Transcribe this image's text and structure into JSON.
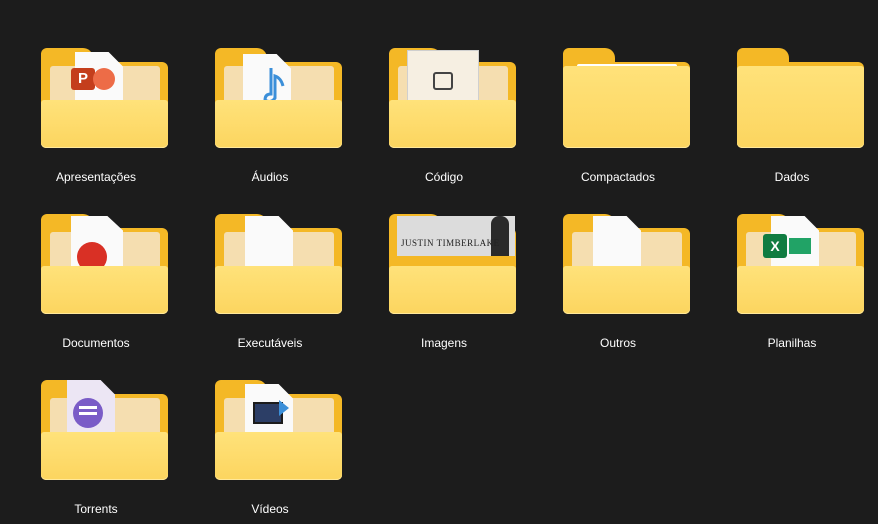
{
  "folders": [
    {
      "name": "Apresentações",
      "preview": "powerpoint-icon"
    },
    {
      "name": "Áudios",
      "preview": "music-note-icon"
    },
    {
      "name": "Código",
      "preview": "code-file-icon"
    },
    {
      "name": "Compactados",
      "preview": "zip-paper-icon"
    },
    {
      "name": "Dados",
      "preview": "empty-folder-icon"
    },
    {
      "name": "Documentos",
      "preview": "pdf-icon"
    },
    {
      "name": "Executáveis",
      "preview": "blank-file-icon"
    },
    {
      "name": "Imagens",
      "preview": "image-thumbnail",
      "thumbnail_text": "JUSTIN TIMBERLAKE"
    },
    {
      "name": "Outros",
      "preview": "blank-file-icon"
    },
    {
      "name": "Planilhas",
      "preview": "excel-icon"
    },
    {
      "name": "Torrents",
      "preview": "torrent-icon"
    },
    {
      "name": "Vídeos",
      "preview": "video-file-icon"
    }
  ],
  "colors": {
    "background": "#1c1c1c",
    "folder_back": "#f4b826",
    "folder_front": "#fcd55f",
    "text": "#ffffff"
  }
}
